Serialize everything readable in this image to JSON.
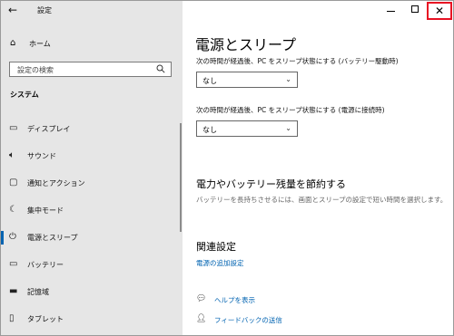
{
  "window": {
    "title": "設定"
  },
  "sidebar": {
    "home_label": "ホーム",
    "search_placeholder": "設定の検索",
    "section_title": "システム",
    "items": [
      {
        "label": "ディスプレイ",
        "icon": "display-icon"
      },
      {
        "label": "サウンド",
        "icon": "speaker-icon"
      },
      {
        "label": "通知とアクション",
        "icon": "notification-icon"
      },
      {
        "label": "集中モード",
        "icon": "moon-icon"
      },
      {
        "label": "電源とスリープ",
        "icon": "power-icon",
        "active": true
      },
      {
        "label": "バッテリー",
        "icon": "battery-icon"
      },
      {
        "label": "記憶域",
        "icon": "storage-icon"
      },
      {
        "label": "タブレット",
        "icon": "tablet-icon"
      }
    ]
  },
  "main": {
    "title": "電源とスリープ",
    "battery_sleep_label": "次の時間が経過後、PC をスリープ状態にする (バッテリー駆動時)",
    "battery_sleep_value": "なし",
    "plugged_sleep_label": "次の時間が経過後、PC をスリープ状態にする (電源に接続時)",
    "plugged_sleep_value": "なし",
    "save_heading": "電力やバッテリー残量を節約する",
    "save_description": "バッテリーを長持ちさせるには、画面とスリープの設定で短い時間を選択します。",
    "related_heading": "関連設定",
    "related_link": "電源の追加設定",
    "help_link": "ヘルプを表示",
    "feedback_link": "フィードバックの送信"
  },
  "colors": {
    "accent": "#0063b1",
    "close_highlight": "#e81123",
    "sidebar_bg": "#e6e6e6"
  }
}
